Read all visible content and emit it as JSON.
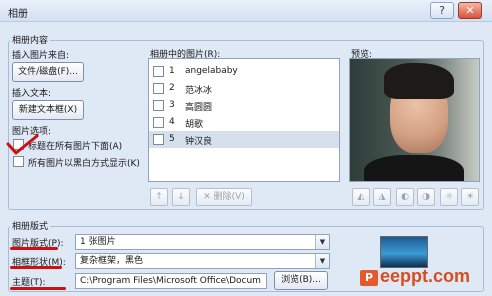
{
  "window": {
    "title": "相册",
    "help_label": "?",
    "close_label": "✕"
  },
  "album_content": {
    "group_title": "相册内容",
    "insert_from_label": "插入图片来自:",
    "file_disk_button": "文件/磁盘(F)...",
    "insert_text_label": "插入文本:",
    "new_textbox_button": "新建文本框(X)",
    "picture_options_label": "图片选项:",
    "caption_below_label": "标题在所有图片下面(A)",
    "black_white_label": "所有图片以黑白方式显示(K)",
    "caption_below_checked": true,
    "black_white_checked": false
  },
  "pictures": {
    "header": "相册中的图片(R):",
    "items": [
      {
        "num": "1",
        "name": "angelababy",
        "selected": false
      },
      {
        "num": "2",
        "name": "范冰冰",
        "selected": false
      },
      {
        "num": "3",
        "name": "高圆圆",
        "selected": false
      },
      {
        "num": "4",
        "name": "胡歌",
        "selected": false
      },
      {
        "num": "5",
        "name": "钟汉良",
        "selected": true
      }
    ],
    "up_icon": "up-arrow-icon",
    "down_icon": "down-arrow-icon",
    "delete_label": "删除(V)"
  },
  "preview": {
    "header": "预览:",
    "tools": [
      "rotate-left-icon",
      "rotate-right-icon",
      "contrast-up-icon",
      "contrast-down-icon",
      "brightness-up-icon",
      "brightness-down-icon"
    ]
  },
  "album_layout": {
    "group_title": "相册版式",
    "picture_layout_label": "图片版式(P):",
    "picture_layout_value": "1 张图片",
    "frame_shape_label": "相框形状(M):",
    "frame_shape_value": "复杂框架，黑色",
    "theme_label": "主题(T):",
    "theme_value": "C:\\Program Files\\Microsoft Office\\Docum",
    "browse_button": "浏览(B)..."
  },
  "watermark": {
    "icon_text": "P",
    "text": "eeppt.com"
  },
  "colors": {
    "dialog_bg": "#dfe8f5",
    "annotation_red": "#cc1111",
    "watermark_orange": "#d94d1c"
  }
}
